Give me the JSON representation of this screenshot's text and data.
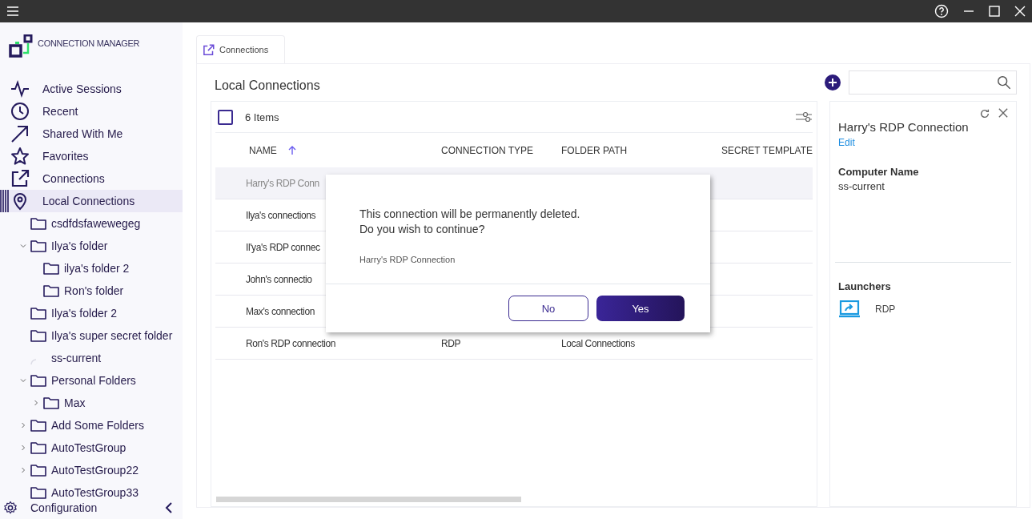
{
  "app": {
    "name": "CONNECTION MANAGER"
  },
  "nav": [
    {
      "label": "Active Sessions",
      "kind": "pulse",
      "selected": false
    },
    {
      "label": "Recent",
      "kind": "clock",
      "selected": false
    },
    {
      "label": "Shared With Me",
      "kind": "arrow",
      "selected": false
    },
    {
      "label": "Favorites",
      "kind": "star",
      "selected": false
    },
    {
      "label": "Connections",
      "kind": "external",
      "selected": false
    },
    {
      "label": "Local Connections",
      "kind": "pin",
      "selected": true
    }
  ],
  "tree": [
    {
      "label": "csdfdsfawewegeg",
      "kind": "folder"
    },
    {
      "label": "Ilya's folder",
      "kind": "folder",
      "expanded": true,
      "children": [
        {
          "label": "ilya's folder 2",
          "kind": "folder"
        },
        {
          "label": "Ron's folder",
          "kind": "folder"
        }
      ]
    },
    {
      "label": "Ilya's folder 2",
      "kind": "folder"
    },
    {
      "label": "Ilya's super secret folder",
      "kind": "folder"
    },
    {
      "label": "ss-current",
      "kind": "server"
    },
    {
      "label": "Personal Folders",
      "kind": "folder",
      "expanded": true,
      "children": [
        {
          "label": "Max",
          "kind": "folder",
          "expanded": false
        }
      ]
    },
    {
      "label": "Add Some Folders",
      "kind": "folder",
      "expanded": false
    },
    {
      "label": "AutoTestGroup",
      "kind": "folder",
      "expanded": false
    },
    {
      "label": "AutoTestGroup22",
      "kind": "folder",
      "expanded": false
    },
    {
      "label": "AutoTestGroup33",
      "kind": "folder"
    }
  ],
  "configuration": {
    "label": "Configuration"
  },
  "tabs": [
    {
      "label": "Connections",
      "selected": true
    }
  ],
  "heading": "Local Connections",
  "table": {
    "count": "6 Items",
    "all_checked": false,
    "columns": [
      {
        "label": "NAME",
        "sorted_ascending": true
      },
      {
        "label": "CONNECTION TYPE"
      },
      {
        "label": "FOLDER PATH"
      },
      {
        "label": "SECRET TEMPLATE"
      }
    ],
    "rows": [
      {
        "name": "Harry's RDP Conn",
        "selected": true
      },
      {
        "name": "Ilya's connections",
        "selected": false
      },
      {
        "name": "Il'ya's RDP connec",
        "selected": false
      },
      {
        "name": "John's connectio",
        "selected": false
      },
      {
        "name": "Max's connection",
        "selected": false
      },
      {
        "name": "Ron's RDP connection",
        "type": "RDP",
        "folder": "Local Connections",
        "selected": false
      }
    ]
  },
  "details": {
    "title": "Harry's RDP Connection",
    "edit": "Edit",
    "fields": [
      {
        "label": "Computer Name",
        "value": "ss-current"
      }
    ],
    "launchers_heading": "Launchers",
    "launchers": [
      {
        "label": "RDP"
      }
    ]
  },
  "dialog": {
    "lines": [
      "This connection will be permanently deleted.",
      "Do you wish to continue?"
    ],
    "subject": "Harry's RDP Connection",
    "buttons": [
      {
        "label": "No",
        "kind": "secondary"
      },
      {
        "label": "Yes",
        "kind": "primary"
      }
    ]
  }
}
